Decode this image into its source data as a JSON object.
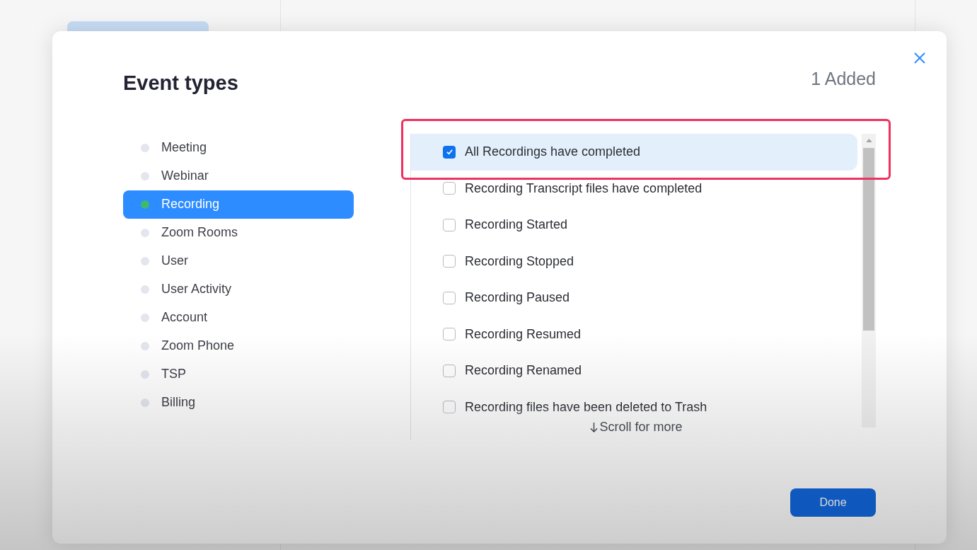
{
  "dialog": {
    "title": "Event types",
    "added_count": "1 Added",
    "categories": [
      {
        "label": "Meeting",
        "selected": false
      },
      {
        "label": "Webinar",
        "selected": false
      },
      {
        "label": "Recording",
        "selected": true
      },
      {
        "label": "Zoom Rooms",
        "selected": false
      },
      {
        "label": "User",
        "selected": false
      },
      {
        "label": "User Activity",
        "selected": false
      },
      {
        "label": "Account",
        "selected": false
      },
      {
        "label": "Zoom Phone",
        "selected": false
      },
      {
        "label": "TSP",
        "selected": false
      },
      {
        "label": "Billing",
        "selected": false
      }
    ],
    "events": [
      {
        "label": "All Recordings have completed",
        "checked": true,
        "selected": true
      },
      {
        "label": "Recording Transcript files have completed",
        "checked": false,
        "selected": false
      },
      {
        "label": "Recording Started",
        "checked": false,
        "selected": false
      },
      {
        "label": "Recording Stopped",
        "checked": false,
        "selected": false
      },
      {
        "label": "Recording Paused",
        "checked": false,
        "selected": false
      },
      {
        "label": "Recording Resumed",
        "checked": false,
        "selected": false
      },
      {
        "label": "Recording Renamed",
        "checked": false,
        "selected": false
      },
      {
        "label": "Recording files have been deleted to Trash",
        "checked": false,
        "selected": false
      }
    ],
    "scroll_hint": "Scroll for more",
    "done_button": "Done"
  }
}
